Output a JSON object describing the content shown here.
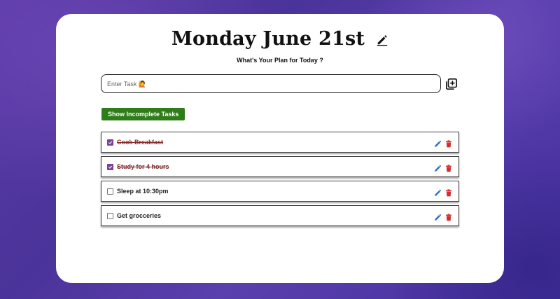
{
  "header": {
    "title": "Monday June 21st",
    "subtitle": "What's Your Plan for Today ?"
  },
  "task_input": {
    "placeholder": "Enter Task 🙋",
    "value": ""
  },
  "filter": {
    "label": "Show Incomplete Tasks"
  },
  "tasks": [
    {
      "text": "Cook Breakfast",
      "completed": true
    },
    {
      "text": "Study for 4 hours",
      "completed": true
    },
    {
      "text": "Sleep at 10:30pm",
      "completed": false
    },
    {
      "text": "Get grocceries",
      "completed": false
    }
  ],
  "icons": {
    "title_edit": "pencil-icon",
    "add_task": "plus-square-icon",
    "task_edit": "pencil-icon",
    "task_delete": "trash-icon"
  },
  "colors": {
    "accent_green": "#2e7d18",
    "checkbox_purple": "#7b3f9e",
    "edit_blue": "#2f6fd0",
    "delete_red": "#d42b2b",
    "completed_text": "#7a2d2d"
  }
}
